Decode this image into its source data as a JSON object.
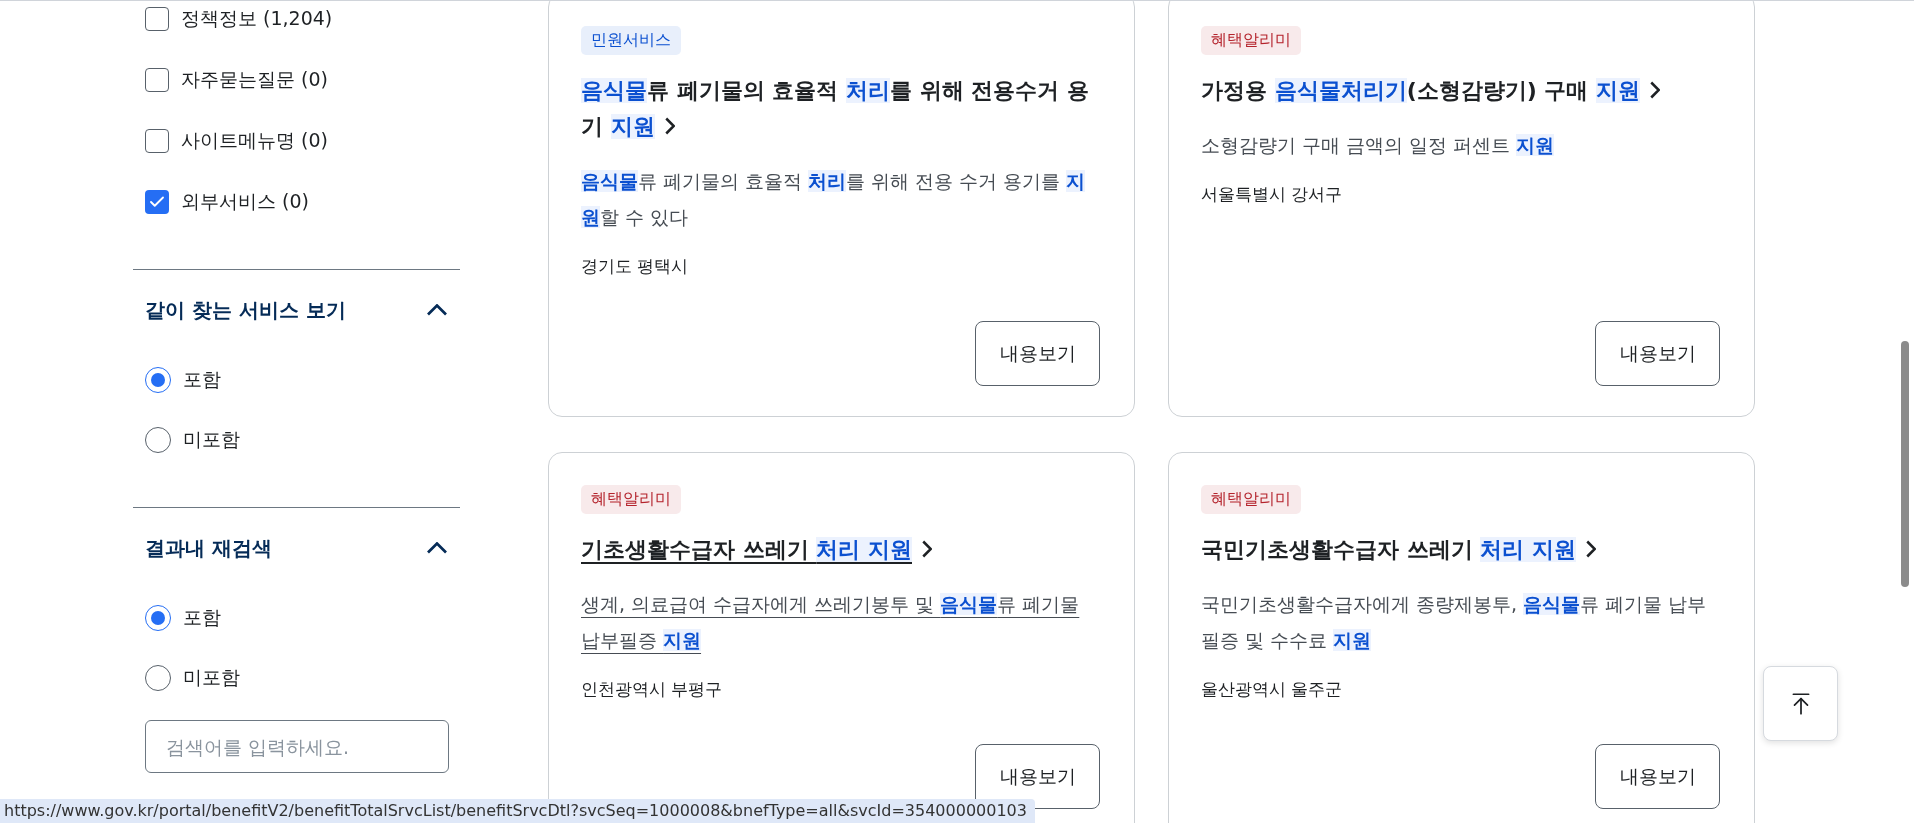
{
  "filters": {
    "checkboxes": [
      {
        "label": "정책정보 (1,204)",
        "checked": false
      },
      {
        "label": "자주묻는질문 (0)",
        "checked": false
      },
      {
        "label": "사이트메뉴명 (0)",
        "checked": false
      },
      {
        "label": "외부서비스 (0)",
        "checked": true
      }
    ],
    "sections": [
      {
        "title": "같이 찾는 서비스 보기",
        "expanded": true,
        "options": [
          {
            "label": "포함",
            "selected": true
          },
          {
            "label": "미포함",
            "selected": false
          }
        ]
      },
      {
        "title": "결과내 재검색",
        "expanded": true,
        "options": [
          {
            "label": "포함",
            "selected": true
          },
          {
            "label": "미포함",
            "selected": false
          }
        ],
        "search": {
          "placeholder": "검색어를 입력하세요."
        }
      }
    ]
  },
  "cards": [
    {
      "tag": {
        "label": "민원서비스",
        "color": "#0b50d0"
      },
      "title": "**음식물**류 폐기물의 효율적 **처리**를 위해 전용수거 용기 **지원**",
      "description": "**음식물**류 폐기물의 효율적 **처리**를 위해 전용 수거 용기를 **지원**할 수 있다",
      "location": "경기도 평택시",
      "button": "내용보기",
      "hovered": false
    },
    {
      "tag": {
        "label": "혜택알리미",
        "color": "#b4232c"
      },
      "title": "가정용 **음식물처리기**(소형감량기) 구매 **지원**",
      "description": "소형감량기 구매 금액의 일정 퍼센트 **지원**",
      "location": "서울특별시 강서구",
      "button": "내용보기",
      "hovered": false
    },
    {
      "tag": {
        "label": "혜택알리미",
        "color": "#b4232c"
      },
      "title": "기초생활수급자 쓰레기 **처리 지원**",
      "description": "생계, 의료급여 수급자에게 쓰레기봉투 및 **음식물**류 폐기물 납부필증 **지원**",
      "location": "인천광역시 부평구",
      "button": "내용보기",
      "hovered": true
    },
    {
      "tag": {
        "label": "혜택알리미",
        "color": "#b4232c"
      },
      "title": "국민기초생활수급자 쓰레기 **처리 지원**",
      "description": "국민기초생활수급자에게 종량제봉투, **음식물**류 폐기물 납부필증 및 수수료 **지원**",
      "location": "울산광역시 울주군",
      "button": "내용보기",
      "hovered": false
    }
  ],
  "status_bar": {
    "url": "https://www.gov.kr/portal/benefitV2/benefitTotalSrvcList/benefitSrvcDtl?svcSeq=1000008&bnefType=all&svcId=354000000103"
  }
}
